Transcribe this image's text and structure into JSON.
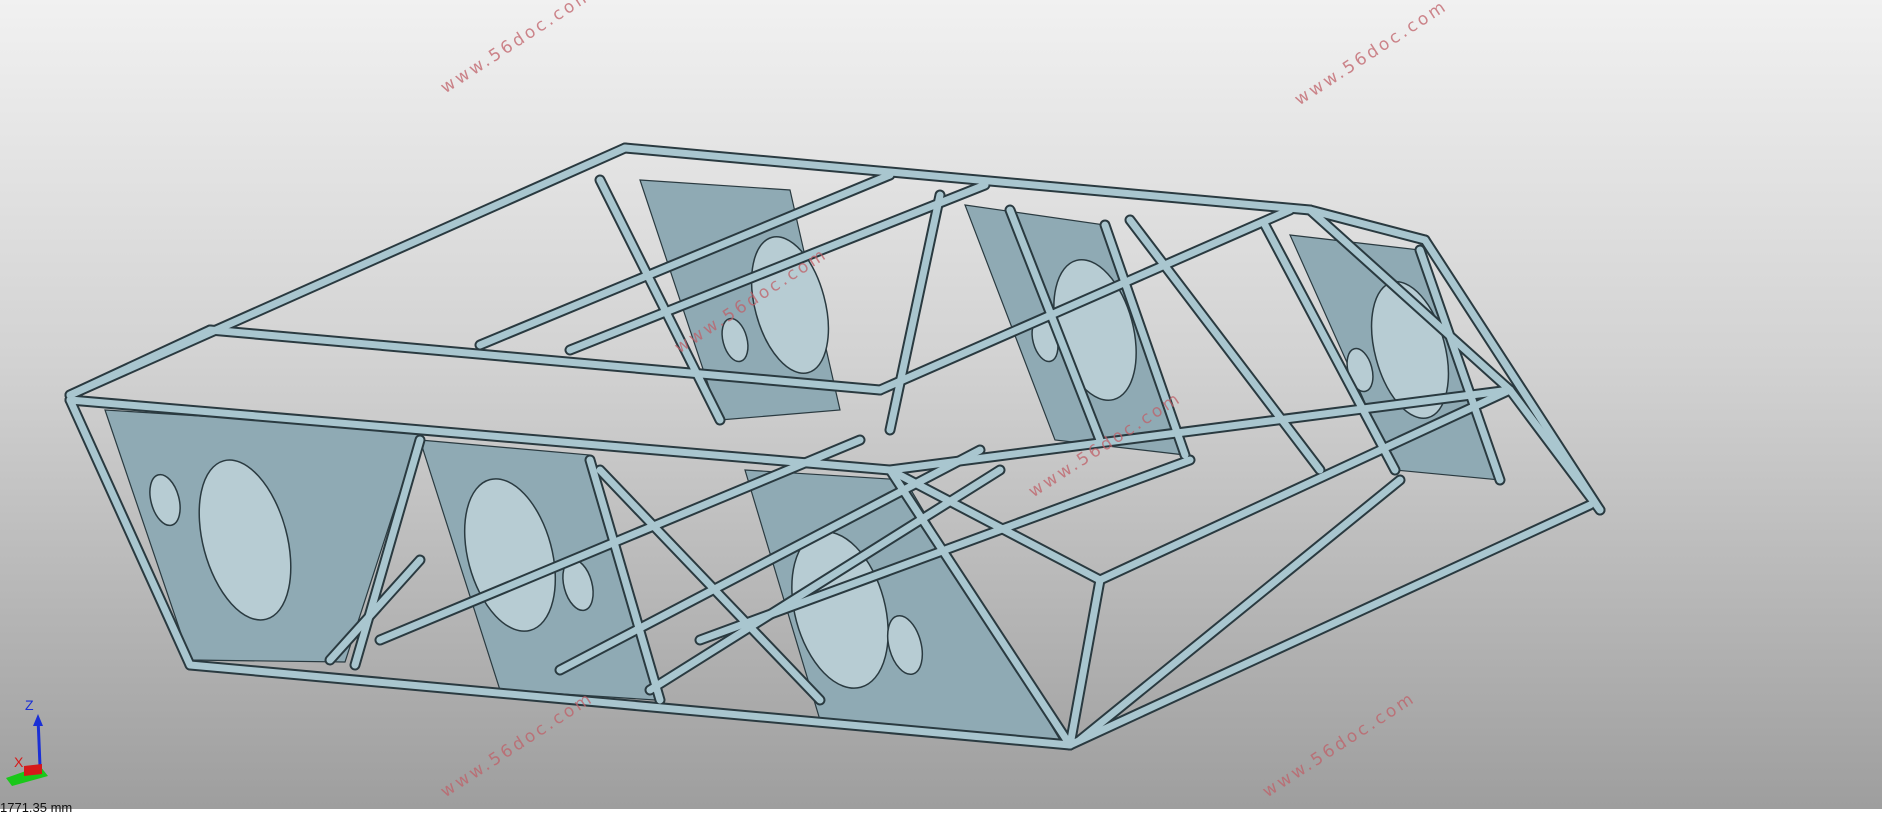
{
  "viewport": {
    "background_top": "#f1f1f1",
    "background_bottom": "#9e9e9e",
    "model_color": "#8faab4",
    "model_edge": "#2a3a40",
    "beam_color": "#a9c6cf"
  },
  "watermarks": [
    "www.56doc.com",
    "www.56doc.com",
    "www.56doc.com",
    "www.56doc.com",
    "www.56doc.com",
    "www.56doc.com"
  ],
  "triad": {
    "z_label": "Z",
    "x_label": "X",
    "z_color": "#1a2fd6",
    "x_color": "#d61a1a",
    "y_color": "#1ac81a"
  },
  "scale_readout": "1771.35 mm"
}
